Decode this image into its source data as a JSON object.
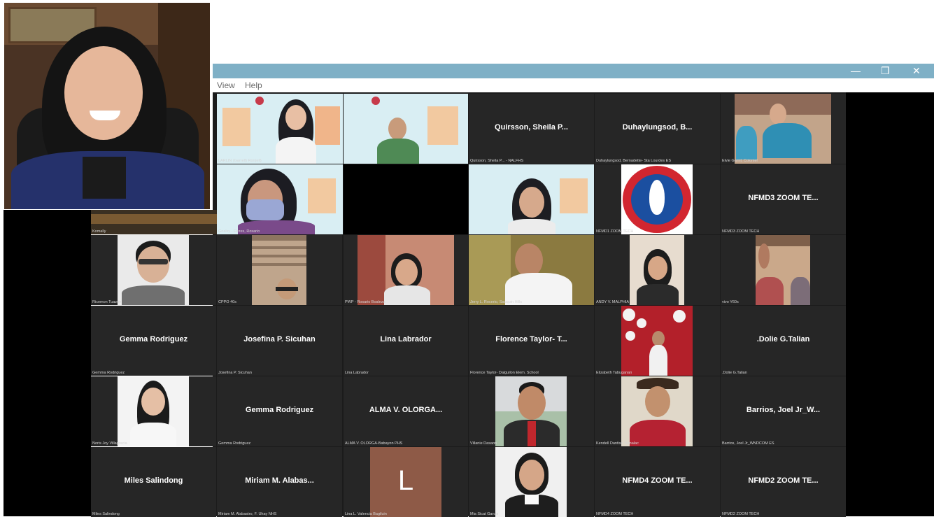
{
  "menu": {
    "view": "View",
    "help": "Help"
  },
  "window_controls": {
    "minimize": "—",
    "restore": "❐",
    "close": "✕"
  },
  "tiles": {
    "r0c2": {
      "name": "Quirsson, Sheila P...",
      "label": "Quirsson, Sheila P... ‐ NALFHS"
    },
    "r0c3": {
      "name": "Duhaylungsod, B...",
      "label": "Duhaylungsod, Bernadette‐ Sta Lourdes ES"
    },
    "r1c5": {
      "name": "NFMD3 ZOOM TE...",
      "label": "NFMD3 ZOOM TECH"
    },
    "r3c0": {
      "name": "Gemma Rodriguez",
      "label": "Gemma Rodriguez"
    },
    "r3c1": {
      "name": "Josefina P. Sicuhan",
      "label": "Josefina P. Sicuhan"
    },
    "r3c2": {
      "name": "Lina Labrador",
      "label": "Lina Labrador"
    },
    "r3c3": {
      "name": "Florence Taylor- T...",
      "label": "Florence Taylor‐ Dalguilon Elem. School"
    },
    "r3c5": {
      "name": ".Dolie G.Talian",
      "label": ".Dolie G.Talian"
    },
    "r4c1": {
      "name": "Gemma Rodriguez",
      "label": "Gemma Rodriguez"
    },
    "r4c2": {
      "name": "ALMA V. OLORGA...",
      "label": "ALMA V. OLORGA‐Babayon PHS"
    },
    "r4c5": {
      "name": "Barrios, Joel Jr_W...",
      "label": "Barrios, Joel Jr_WNDCOM ES"
    },
    "r5c0": {
      "name": "Miles Salindong",
      "label": "Miles Salindong"
    },
    "r5c1": {
      "name": "Miriam M. Alabas...",
      "label": "Miriam M. Alabastro, F. Uhay NHS"
    },
    "r5c4": {
      "name": "NFMD4 ZOOM TE...",
      "label": "NFMD4 ZOOM TECH"
    },
    "r5c5": {
      "name": "NFMD2 ZOOM TE...",
      "label": "NFMD2 ZOOM TECH"
    }
  },
  "video_labels": {
    "r0c0": "LARLIN (Garrell) Ron(ell)",
    "r0c3b": "Elvie Gamil, Coloniel",
    "r1c0": "Goalsy - Flores, Rosario",
    "r1c4": "NFMD1 ZOOM TECH",
    "r1c0b": "Komally",
    "r2c0": "Ricemon Tuazon",
    "r2c1": "CPPO 40s",
    "r2c2": "PWP - Rosario Boaleza",
    "r2c3": "Jerry L. Rocerio, Sauquin Hills",
    "r2c4": "ANDY V. MALPHIA",
    "r2c5": "vivo Y60s",
    "r3c4": "Elizabeth Tabuganan",
    "r4c0": "Noris Joy Villagracia",
    "r4c3": "Villanie Dasaon",
    "r4c4": "Kendell Dantiso Tumalac",
    "r5c2": "Lina L. Valencia Bagiluin",
    "r5c3": "Mia Sicat Garcia"
  },
  "avatar_letter": "L"
}
